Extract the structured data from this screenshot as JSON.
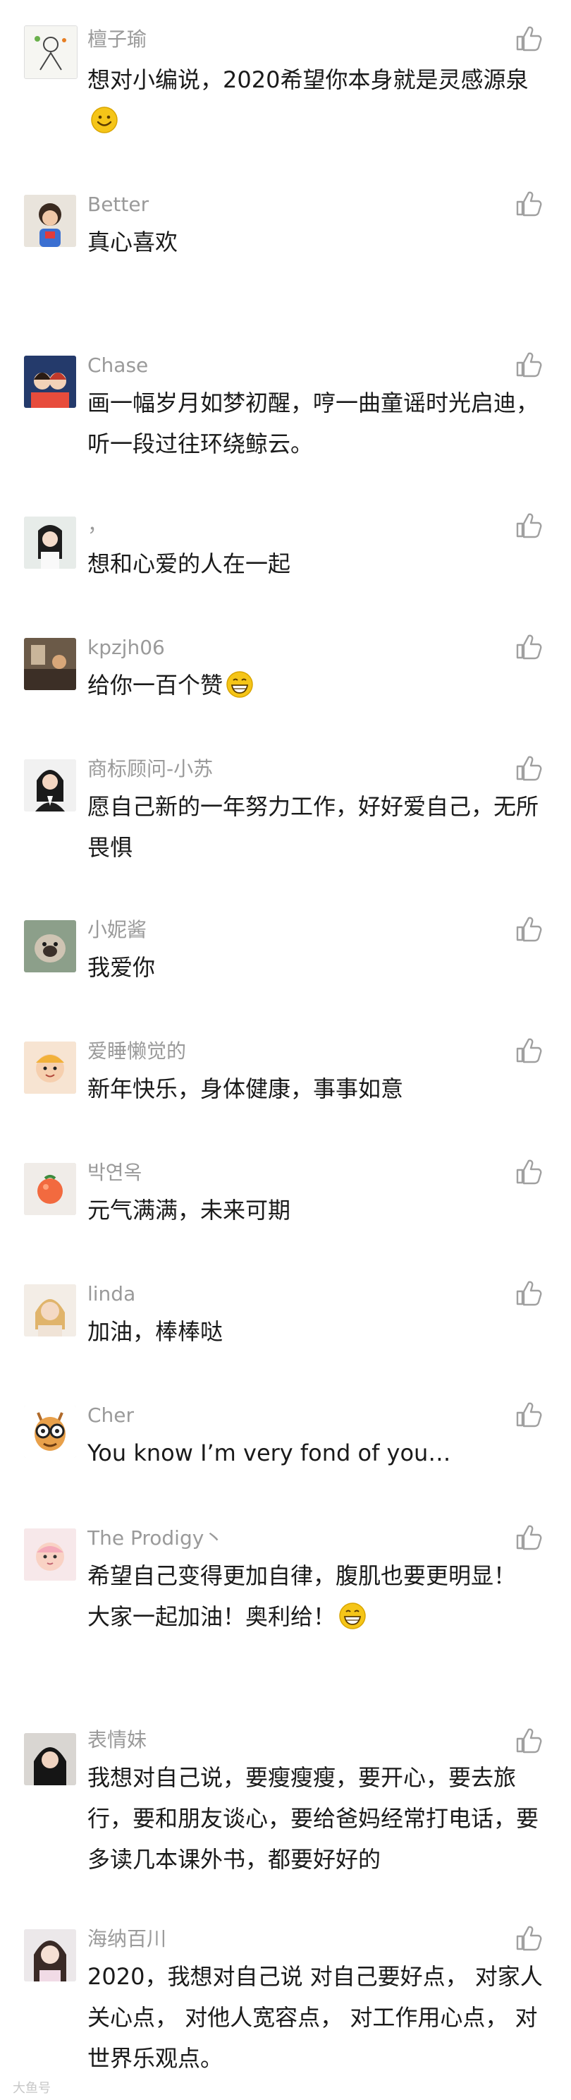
{
  "comments": [
    {
      "name": "檀子瑜",
      "text": "想对小编说，2020希望你本身就是灵感源泉",
      "emoji": "smile",
      "avatar": "avatar-sketch-figure"
    },
    {
      "name": "Better",
      "text": "真心喜欢",
      "avatar": "avatar-child-photo"
    },
    {
      "name": "Chase",
      "text": "画一幅岁月如梦初醒，哼一曲童谣时光启迪，听一段过往环绕鲸云。",
      "avatar": "avatar-couple-illustration"
    },
    {
      "name": "，",
      "text": "想和心爱的人在一起",
      "avatar": "avatar-woman-photo"
    },
    {
      "name": "kpzjh06",
      "text": "给你一百个赞",
      "emoji": "grin",
      "avatar": "avatar-indoor-photo"
    },
    {
      "name": "商标顾问-小苏",
      "text": "愿自己新的一年努力工作，好好爱自己，无所畏惧",
      "avatar": "avatar-business-woman"
    },
    {
      "name": "小妮酱",
      "text": "我爱你",
      "avatar": "avatar-dog-photo"
    },
    {
      "name": "爱睡懒觉的",
      "text": "新年快乐，身体健康，事事如意",
      "avatar": "avatar-baby-photo"
    },
    {
      "name": "박연옥",
      "text": "元气满满，未来可期",
      "avatar": "avatar-tomato-photo"
    },
    {
      "name": "linda",
      "text": "加油，棒棒哒",
      "avatar": "avatar-blonde-photo"
    },
    {
      "name": "Cher",
      "text": "You know I’m very fond of you…",
      "avatar": "avatar-giraffe-glasses"
    },
    {
      "name": "The Prodigy丶",
      "text": "希望自己变得更加自律，腹肌也要更明显！\n大家一起加油！奥利给！",
      "emoji": "grin",
      "avatar": "avatar-baby-pink"
    },
    {
      "name": "表情妹",
      "text": "我想对自己说，要瘦瘦瘦，要开心，要去旅行，要和朋友谈心，要给爸妈经常打电话，要多读几本课外书，都要好好的",
      "avatar": "avatar-girl-dark"
    },
    {
      "name": "海纳百川",
      "text": "2020，我想对自己说 对自己要好点， 对家人关心点， 对他人宽容点， 对工作用心点， 对世界乐观点。",
      "avatar": "avatar-girl-light"
    }
  ],
  "watermark": "大鱼号",
  "colors": {
    "name": "#9a9a9a",
    "text": "#1a1a1a",
    "like_icon": "#a0a0a0",
    "emoji": "#f5c518"
  }
}
